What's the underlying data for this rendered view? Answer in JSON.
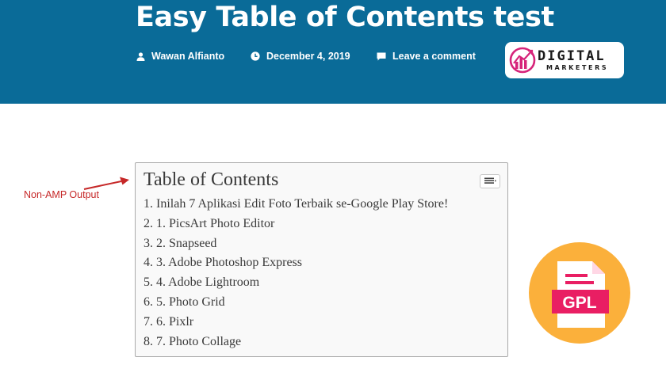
{
  "header": {
    "title": "Easy Table of Contents test",
    "author": "Wawan Alfianto",
    "date": "December 4, 2019",
    "comment_link": "Leave a comment",
    "background": "#0a6b98"
  },
  "logo": {
    "line1": "DIGITAL",
    "line2": "MARKETERS",
    "accent": "#d6247a"
  },
  "annotation": {
    "label": "Non-AMP Output",
    "color": "#c62828"
  },
  "toc": {
    "title": "Table of Contents",
    "toggle_icon": "list-toggle-icon",
    "items": [
      "1. Inilah 7 Aplikasi Edit Foto Terbaik se-Google Play Store!",
      "2. 1. PicsArt Photo Editor",
      "3. 2. Snapseed",
      "4. 3. Adobe Photoshop Express",
      "5. 4. Adobe Lightroom",
      "6. 5. Photo Grid",
      "7. 6. Pixlr",
      "8. 7. Photo Collage"
    ]
  },
  "badge": {
    "text": "GPL",
    "circle_color": "#fbb03b",
    "file_color": "#e91e63"
  }
}
